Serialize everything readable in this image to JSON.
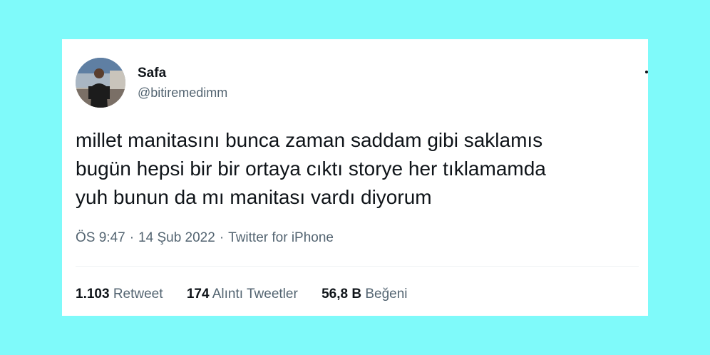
{
  "tweet": {
    "author": {
      "display_name": "Safa",
      "handle": "@bitiremedimm"
    },
    "text": "millet manitasını bunca zaman saddam gibi saklamıs\nbugün hepsi bir bir ortaya cıktı storye her tıklamamda\nyuh bunun da mı manitası vardı diyorum",
    "time": "ÖS 9:47",
    "date": "14 Şub 2022",
    "source": "Twitter for iPhone",
    "separator": "·",
    "stats": {
      "retweets_count": "1.103",
      "retweets_label": "Retweet",
      "quotes_count": "174",
      "quotes_label": "Alıntı Tweetler",
      "likes_count": "56,8 B",
      "likes_label": "Beğeni"
    }
  },
  "colors": {
    "background": "#7ffafa",
    "card": "#ffffff",
    "text_primary": "#0f1419",
    "text_secondary": "#536471"
  }
}
